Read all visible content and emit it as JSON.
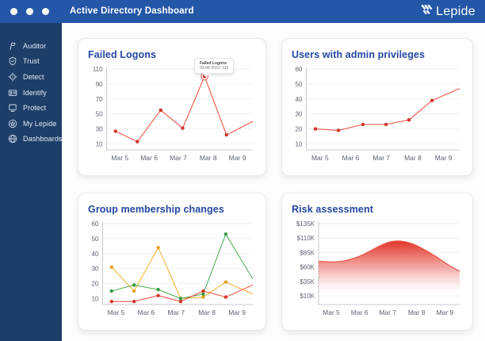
{
  "header": {
    "title": "Active Directory Dashboard",
    "brand": "Lepide",
    "bg": "#2457a8"
  },
  "sidebar": {
    "bg": "#1d3e68",
    "items": [
      {
        "icon": "auditor-flag-icon",
        "label": "Auditor"
      },
      {
        "icon": "trust-shield-icon",
        "label": "Trust"
      },
      {
        "icon": "detect-target-icon",
        "label": "Detect"
      },
      {
        "icon": "identify-idcard-icon",
        "label": "Identify"
      },
      {
        "icon": "protect-screen-icon",
        "label": "Protect"
      },
      {
        "icon": "my-lepide-star-icon",
        "label": "My Lepide"
      },
      {
        "icon": "dashboards-globe-icon",
        "label": "Dashboards"
      }
    ]
  },
  "colors": {
    "card_title": "#2347a2",
    "axis": "#c4c9d2",
    "grid": "#f1f2f6",
    "tick_text": "#5c6370",
    "red_line": "#ec574a",
    "red_dot": "#d0352a",
    "yellow_line": "#f0b63c",
    "yellow_dot": "#e5a224",
    "green_line": "#53ae57",
    "green_dot": "#3b9a43",
    "area_top": "#e02b1e"
  },
  "chart_data": [
    {
      "type": "line",
      "title": "Failed Logons",
      "xticks": [
        {
          "f": 0.09,
          "label": "Mar 5"
        },
        {
          "f": 0.29,
          "label": "Mar 6"
        },
        {
          "f": 0.49,
          "label": "Mar 7"
        },
        {
          "f": 0.695,
          "label": "Mar 8"
        },
        {
          "f": 0.895,
          "label": "Mar 9"
        }
      ],
      "ytick_values": [
        10,
        30,
        50,
        70,
        90,
        110
      ],
      "ytick_labels": [
        "10",
        "30",
        "50",
        "70",
        "90",
        "110"
      ],
      "ymin": 2,
      "ymax": 110,
      "series": [
        {
          "name": "red",
          "color_key": "red_line",
          "dot_key": "red_dot",
          "x": [
            0.06,
            0.21,
            0.37,
            0.52,
            0.67,
            0.82,
            1.0
          ],
          "values": [
            27,
            13,
            55,
            31,
            100,
            22,
            40
          ],
          "dots": [
            true,
            true,
            true,
            true,
            true,
            true,
            false
          ]
        }
      ],
      "tooltip": {
        "line1": "Failed Logons",
        "line2": "03-08-2023: 110",
        "series": 0,
        "point_index": 4
      }
    },
    {
      "type": "line",
      "title": "Users with admin privileges",
      "xticks": [
        {
          "f": 0.09,
          "label": "Mar 5"
        },
        {
          "f": 0.29,
          "label": "Mar 6"
        },
        {
          "f": 0.49,
          "label": "Mar 7"
        },
        {
          "f": 0.695,
          "label": "Mar 8"
        },
        {
          "f": 0.895,
          "label": "Mar 9"
        }
      ],
      "ytick_values": [
        10,
        20,
        30,
        40,
        50,
        60
      ],
      "ytick_labels": [
        "10",
        "20",
        "30",
        "40",
        "50",
        "60"
      ],
      "ymin": 6,
      "ymax": 60,
      "series": [
        {
          "name": "red",
          "color_key": "red_line",
          "dot_key": "red_dot",
          "x": [
            0.06,
            0.21,
            0.37,
            0.52,
            0.67,
            0.82,
            1.0
          ],
          "values": [
            20,
            19,
            23,
            23,
            26,
            39,
            47
          ],
          "dots": [
            true,
            true,
            true,
            true,
            true,
            true,
            false
          ]
        }
      ]
    },
    {
      "type": "line",
      "title": "Group membership changes",
      "xticks": [
        {
          "f": 0.09,
          "label": "Mar 5"
        },
        {
          "f": 0.29,
          "label": "Mar 6"
        },
        {
          "f": 0.49,
          "label": "Mar 7"
        },
        {
          "f": 0.695,
          "label": "Mar 8"
        },
        {
          "f": 0.895,
          "label": "Mar 9"
        }
      ],
      "ytick_values": [
        10,
        20,
        30,
        40,
        50,
        60
      ],
      "ytick_labels": [
        "10",
        "20",
        "30",
        "40",
        "50",
        "60"
      ],
      "ymin": 6,
      "ymax": 60,
      "series": [
        {
          "name": "yellow",
          "color_key": "yellow_line",
          "dot_key": "yellow_dot",
          "x": [
            0.06,
            0.21,
            0.37,
            0.52,
            0.67,
            0.82,
            1.0
          ],
          "values": [
            31,
            15,
            44,
            10,
            11,
            21,
            13
          ],
          "dots": [
            true,
            true,
            true,
            true,
            true,
            true,
            false
          ]
        },
        {
          "name": "green",
          "color_key": "green_line",
          "dot_key": "green_dot",
          "x": [
            0.06,
            0.21,
            0.37,
            0.52,
            0.67,
            0.82,
            1.0
          ],
          "values": [
            15,
            19,
            16,
            10,
            13,
            53,
            23
          ],
          "dots": [
            true,
            true,
            true,
            true,
            true,
            true,
            false
          ]
        },
        {
          "name": "red",
          "color_key": "red_line",
          "dot_key": "red_dot",
          "x": [
            0.06,
            0.21,
            0.37,
            0.52,
            0.67,
            0.82,
            1.0
          ],
          "values": [
            8,
            8,
            12,
            8,
            15,
            11,
            19
          ],
          "dots": [
            true,
            true,
            true,
            true,
            true,
            true,
            false
          ]
        }
      ]
    },
    {
      "type": "area",
      "title": "Risk assessment",
      "xticks": [
        {
          "f": 0.09,
          "label": "Mar 5"
        },
        {
          "f": 0.29,
          "label": "Mar 6"
        },
        {
          "f": 0.49,
          "label": "Mar 7"
        },
        {
          "f": 0.695,
          "label": "Mar 8"
        },
        {
          "f": 0.895,
          "label": "Mar 9"
        }
      ],
      "ytick_values": [
        10,
        35,
        60,
        85,
        110,
        135
      ],
      "ytick_labels": [
        "$10K",
        "$35K",
        "$60K",
        "$85K",
        "$110K",
        "$135K"
      ],
      "ymin": -5,
      "ymax": 135,
      "series": [
        {
          "name": "risk",
          "color_key": "red_line",
          "area": true,
          "x": [
            0,
            0.0625,
            0.125,
            0.1875,
            0.25,
            0.3125,
            0.375,
            0.4375,
            0.5,
            0.5625,
            0.625,
            0.6875,
            0.75,
            0.8125,
            0.875,
            0.9375,
            1
          ],
          "values": [
            70,
            69,
            69,
            71,
            75,
            81,
            89,
            97,
            103,
            105,
            103,
            98,
            90,
            81,
            71,
            61,
            53
          ],
          "dots": []
        }
      ]
    }
  ]
}
